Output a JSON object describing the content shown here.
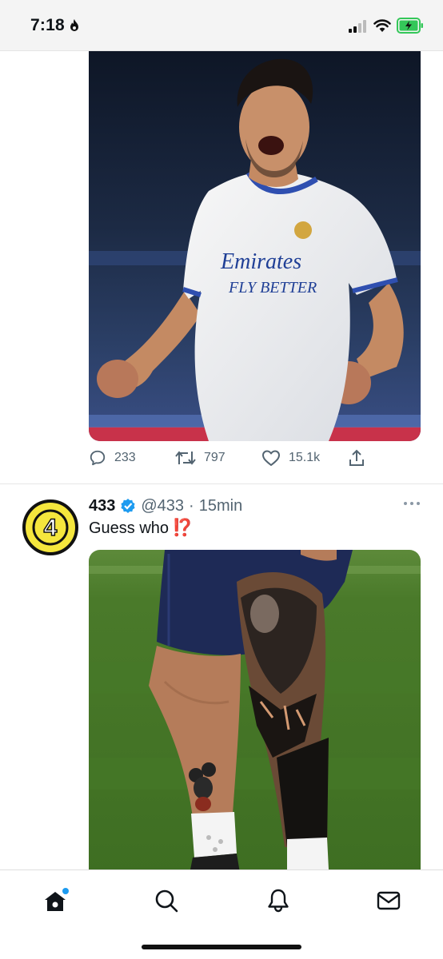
{
  "status_bar": {
    "time": "7:18"
  },
  "tweet1": {
    "image_alt_icon": "photo-footballer-celebrating",
    "replies": "233",
    "retweets": "797",
    "likes": "15.1k"
  },
  "tweet2": {
    "display_name": "433",
    "verified": true,
    "handle": "@433",
    "separator": "·",
    "time": "15min",
    "text": "Guess who",
    "emoji": "⁉️",
    "avatar_text": "4",
    "image_alt_icon": "photo-tattooed-leg"
  },
  "tab_bar": {
    "items": [
      "home",
      "search",
      "notifications",
      "messages"
    ],
    "accent": "#1d9bf0"
  }
}
